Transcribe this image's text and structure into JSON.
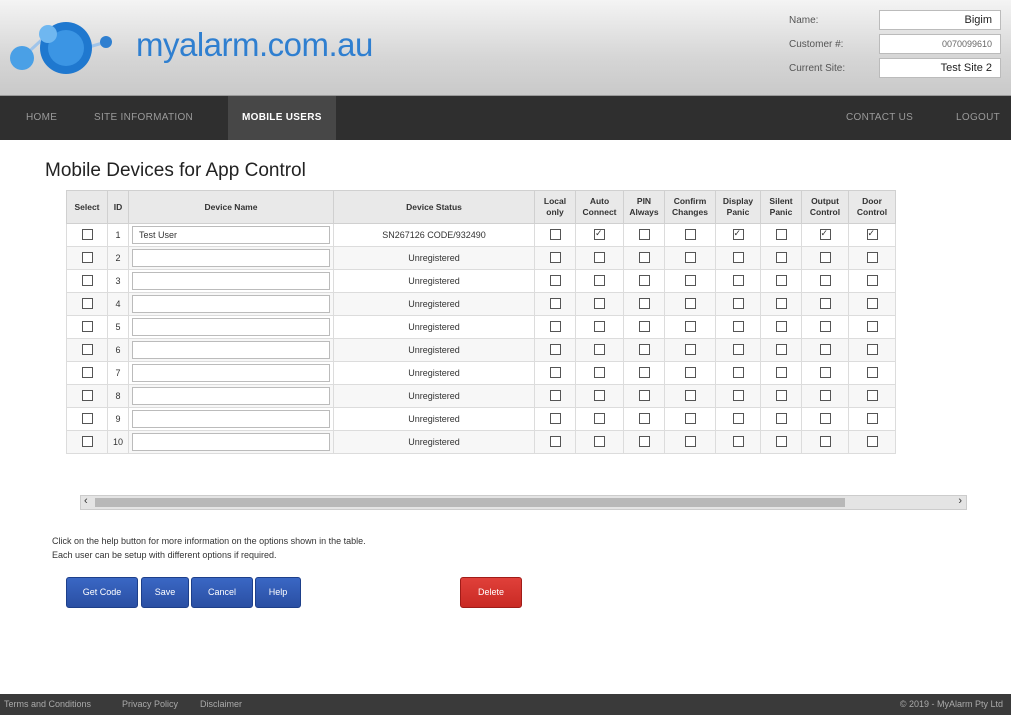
{
  "header": {
    "logo_text": "myalarm.com.au",
    "account": {
      "name_label": "Name:",
      "name_value": "Bigim",
      "customer_label": "Customer #:",
      "customer_value": "0070099610",
      "site_label": "Current Site:",
      "site_value": "Test Site 2"
    }
  },
  "nav": {
    "home": "HOME",
    "site_information": "SITE INFORMATION",
    "mobile_users": "MOBILE USERS",
    "contact_us": "CONTACT US",
    "logout": "LOGOUT"
  },
  "page_title": "Mobile Devices for App Control",
  "table": {
    "headers": {
      "select": "Select",
      "id": "ID",
      "device_name": "Device Name",
      "device_status": "Device Status",
      "local_only": "Local only",
      "auto_connect": "Auto Connect",
      "pin_always": "PIN Always",
      "confirm_changes": "Confirm Changes",
      "display_panic": "Display Panic",
      "silent_panic": "Silent Panic",
      "output_control": "Output Control",
      "door_control": "Door Control"
    },
    "rows": [
      {
        "id": "1",
        "name": "Test User",
        "status": "SN267126 CODE/932490",
        "local": false,
        "auto": true,
        "pin": false,
        "confirm": false,
        "display": true,
        "silent": false,
        "output": true,
        "door": true
      },
      {
        "id": "2",
        "name": "",
        "status": "Unregistered",
        "local": false,
        "auto": false,
        "pin": false,
        "confirm": false,
        "display": false,
        "silent": false,
        "output": false,
        "door": false
      },
      {
        "id": "3",
        "name": "",
        "status": "Unregistered",
        "local": false,
        "auto": false,
        "pin": false,
        "confirm": false,
        "display": false,
        "silent": false,
        "output": false,
        "door": false
      },
      {
        "id": "4",
        "name": "",
        "status": "Unregistered",
        "local": false,
        "auto": false,
        "pin": false,
        "confirm": false,
        "display": false,
        "silent": false,
        "output": false,
        "door": false
      },
      {
        "id": "5",
        "name": "",
        "status": "Unregistered",
        "local": false,
        "auto": false,
        "pin": false,
        "confirm": false,
        "display": false,
        "silent": false,
        "output": false,
        "door": false
      },
      {
        "id": "6",
        "name": "",
        "status": "Unregistered",
        "local": false,
        "auto": false,
        "pin": false,
        "confirm": false,
        "display": false,
        "silent": false,
        "output": false,
        "door": false
      },
      {
        "id": "7",
        "name": "",
        "status": "Unregistered",
        "local": false,
        "auto": false,
        "pin": false,
        "confirm": false,
        "display": false,
        "silent": false,
        "output": false,
        "door": false
      },
      {
        "id": "8",
        "name": "",
        "status": "Unregistered",
        "local": false,
        "auto": false,
        "pin": false,
        "confirm": false,
        "display": false,
        "silent": false,
        "output": false,
        "door": false
      },
      {
        "id": "9",
        "name": "",
        "status": "Unregistered",
        "local": false,
        "auto": false,
        "pin": false,
        "confirm": false,
        "display": false,
        "silent": false,
        "output": false,
        "door": false
      },
      {
        "id": "10",
        "name": "",
        "status": "Unregistered",
        "local": false,
        "auto": false,
        "pin": false,
        "confirm": false,
        "display": false,
        "silent": false,
        "output": false,
        "door": false
      }
    ]
  },
  "help_text": {
    "line1": "Click on the help button for more information on the options shown in the table.",
    "line2": "Each user can be setup with different options if required."
  },
  "buttons": {
    "get_code": "Get Code",
    "save": "Save",
    "cancel": "Cancel",
    "help": "Help",
    "delete": "Delete"
  },
  "footer": {
    "terms": "Terms and Conditions",
    "privacy": "Privacy Policy",
    "disclaimer": "Disclaimer",
    "copyright": "© 2019 - MyAlarm Pty Ltd"
  },
  "colors": {
    "nav_bg": "#2f2f2f",
    "button_blue": "#2a4fa3",
    "button_red": "#c92a24",
    "logo_blue": "#2f7fd0"
  }
}
